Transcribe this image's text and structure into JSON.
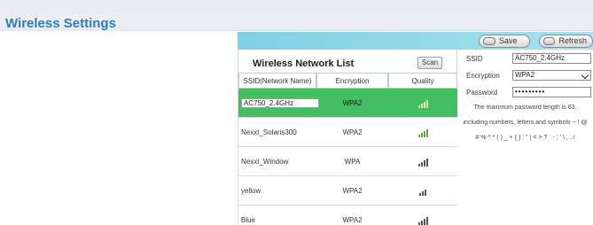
{
  "page": {
    "title": "Wireless Settings"
  },
  "toolbar": {
    "save_label": "Save",
    "refresh_label": "Refresh"
  },
  "wireless_list": {
    "title": "Wireless Network List",
    "scan_label": "Scan",
    "columns": [
      "SSID(Network Name)",
      "Encryption",
      "Quality"
    ],
    "rows": [
      {
        "ssid": "AC750_2.4GHz",
        "encryption": "WPA2",
        "quality": 3,
        "selected": true
      },
      {
        "ssid": "Nexxt_Solaris300",
        "encryption": "WPA2",
        "quality": 4,
        "selected": false
      },
      {
        "ssid": "Nexxt_Window",
        "encryption": "WPA",
        "quality": 4,
        "selected": false
      },
      {
        "ssid": "yellow",
        "encryption": "WPA2",
        "quality": 3,
        "selected": false
      },
      {
        "ssid": "Blue",
        "encryption": "WPA2",
        "quality": 4,
        "selected": false
      }
    ]
  },
  "settings": {
    "ssid_label": "SSID",
    "ssid_value": "AC750_2.4GHz",
    "encryption_label": "Encryption",
    "encryption_value": "WPA2",
    "password_label": "Password",
    "password_value": "•••••••••",
    "note_line1": "The maximum password length is 63,",
    "note_line2": "including numbers, letters and symbols ~ ! @",
    "note_line3": "# % ^ * ( ) _ + { } : \" | < > ? ` - ; ' \\ , . /"
  },
  "colors": {
    "title": "#2f7bc1",
    "topbar": "#7fd0e3",
    "selected_row": "#43be63"
  }
}
